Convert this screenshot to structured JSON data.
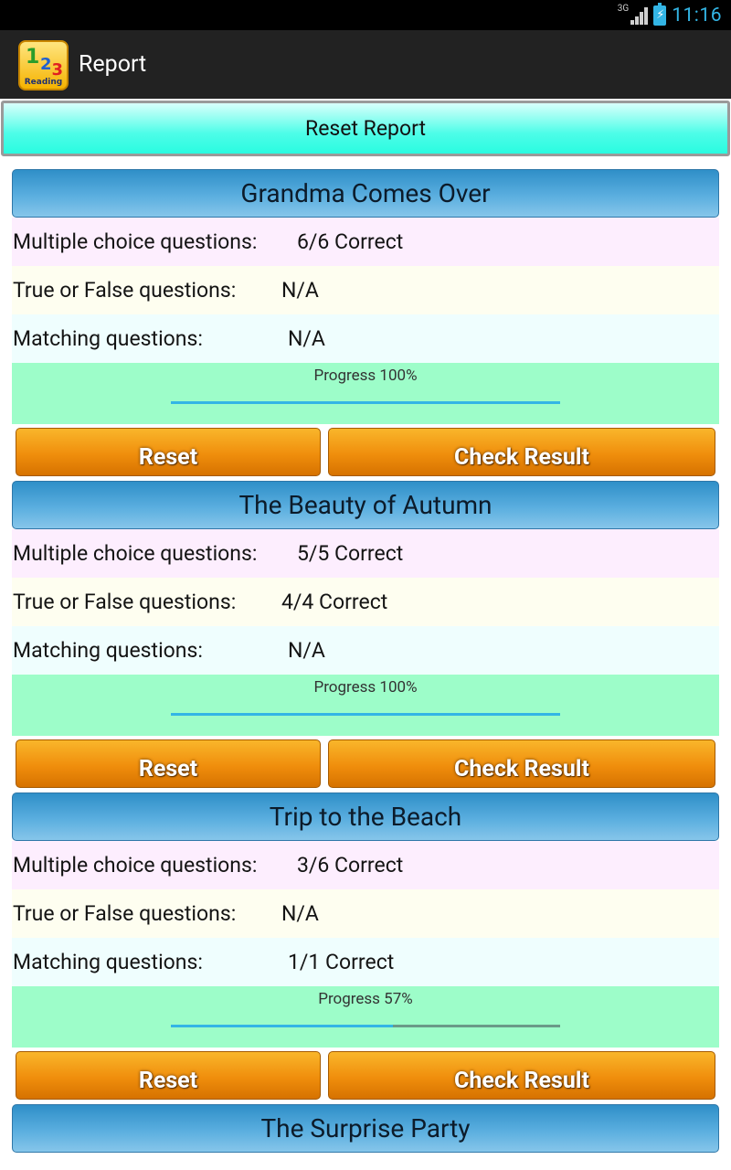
{
  "status_bar": {
    "network": "3G",
    "time": "11:16",
    "icons": [
      "signal-icon",
      "battery-charging-icon"
    ]
  },
  "action_bar": {
    "title": "Report",
    "app_icon": "reading-123-app-icon"
  },
  "reset_report_label": "Reset Report",
  "labels": {
    "multiple_choice": "Multiple choice questions:",
    "true_false": "True or False questions:",
    "matching": "Matching questions:"
  },
  "sections": [
    {
      "title": "Grandma Comes Over",
      "multiple_choice": "6/6 Correct",
      "true_false": "N/A",
      "matching": "N/A",
      "progress_label": "Progress 100%",
      "progress": 100,
      "reset_label": "Reset",
      "check_label": "Check Result"
    },
    {
      "title": "The Beauty of Autumn",
      "multiple_choice": "5/5 Correct",
      "true_false": "4/4 Correct",
      "matching": "N/A",
      "progress_label": "Progress 100%",
      "progress": 100,
      "reset_label": "Reset",
      "check_label": "Check Result"
    },
    {
      "title": "Trip to the Beach",
      "multiple_choice": "3/6 Correct",
      "true_false": "N/A",
      "matching": "1/1 Correct",
      "progress_label": "Progress 57%",
      "progress": 57,
      "reset_label": "Reset",
      "check_label": "Check Result"
    },
    {
      "title": "The Surprise Party"
    }
  ],
  "colors": {
    "status_accent": "#33b5e5",
    "action_bar": "#222222",
    "reset_report": "#2afbe0",
    "section_header": "#5aaedf",
    "button": "#f08e0c",
    "progress_bg": "#9dfdc9"
  }
}
